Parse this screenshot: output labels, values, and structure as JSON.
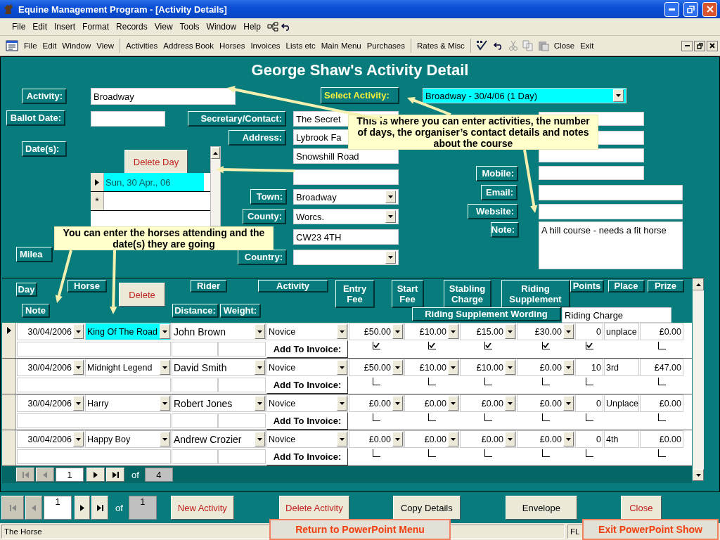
{
  "window": {
    "title": "Equine Management Program - [Activity Details]"
  },
  "menu_bar": [
    "File",
    "Edit",
    "Insert",
    "Format",
    "Records",
    "View",
    "Tools",
    "Window",
    "Help"
  ],
  "toolbar": {
    "window_menu": [
      "File",
      "Edit",
      "Window",
      "View"
    ],
    "sections": [
      "Activities",
      "Address Book",
      "Horses",
      "Invoices",
      "Lists etc",
      "Main Menu",
      "Purchases"
    ],
    "misc": [
      "Rates & Misc"
    ],
    "actions": [
      "Close",
      "Exit"
    ]
  },
  "form": {
    "heading": "George Shaw's Activity Detail",
    "select_activity": {
      "label": "Select Activity:",
      "value": "Broadway - 30/4/06 (1 Day)"
    },
    "fields": [
      {
        "label": "Activity:",
        "value": "Broadway",
        "kind": "text"
      },
      {
        "label": "Ballot Date:",
        "kind": "text"
      },
      {
        "label": "Secretary/Contact:",
        "value": "The Secret",
        "kind": "text"
      },
      {
        "label": "Address:",
        "value": "Lybrook Fa",
        "kind": "text"
      },
      {
        "value": "Snowshill Road",
        "kind": "text"
      },
      {
        "kind": "text"
      },
      {
        "label": "Town:",
        "value": "Broadway",
        "kind": "combo"
      },
      {
        "label": "County:",
        "value": "Worcs.",
        "kind": "combo"
      },
      {
        "value": "CW23 4TH",
        "kind": "text"
      },
      {
        "label": "Country:",
        "kind": "combo"
      },
      {
        "label": "Milea",
        "kind": "label"
      },
      {
        "kind": "text"
      },
      {
        "kind": "text"
      },
      {
        "kind": "text"
      },
      {
        "label": "Mobile:",
        "kind": "text"
      },
      {
        "label": "Email:",
        "kind": "text"
      },
      {
        "label": "Website:",
        "kind": "text"
      },
      {
        "label": "Note:",
        "value": "A hill course - needs a fit horse",
        "kind": "memo"
      }
    ],
    "dates_label": "Date(s):",
    "delete_day_button": "Delete Day",
    "dates": [
      {
        "text": "Sun, 30 Apr., 06",
        "selected": true
      }
    ],
    "new_row_marker": "*",
    "callouts": [
      "This is where you can enter activities, the number of days, the organiser’s contact details and notes about the course",
      "You can enter the horses attending and the date(s) they are going"
    ]
  },
  "subform": {
    "headers": [
      "Day",
      "Horse",
      "Rider",
      "Activity",
      "Entry Fee",
      "Start Fee",
      "Stabling Charge",
      "Riding Supplement",
      "Points",
      "Place",
      "Prize",
      "Note",
      "Distance:",
      "Weight:",
      "Riding Supplement  Wording"
    ],
    "delete_button": "Delete",
    "riding_charge": "Riding Charge",
    "rows": [
      {
        "selected": true,
        "date": "30/04/2006",
        "horse": "King Of The Road",
        "rider": "John Brown",
        "activity": "Novice",
        "fees": [
          "£50.00",
          "£10.00",
          "£15.00",
          "£30.00"
        ],
        "points": "0",
        "place": "unplace",
        "prize": "£0.00",
        "invoice_label": "Add To Invoice:",
        "invoice": [
          {
            "checked": true
          },
          {
            "checked": true
          },
          {
            "checked": true
          },
          {
            "checked": true
          },
          {
            "checked": true
          },
          {
            "checked": false
          }
        ]
      },
      {
        "selected": false,
        "date": "30/04/2006",
        "horse": "Midnight Legend",
        "rider": "David Smith",
        "activity": "Novice",
        "fees": [
          "£50.00",
          "£10.00",
          "£10.00",
          "£0.00"
        ],
        "points": "10",
        "place": "3rd",
        "prize": "£47.00",
        "invoice_label": "Add To Invoice:",
        "invoice": [
          {
            "checked": false
          },
          {
            "checked": false
          },
          {
            "checked": false
          },
          {
            "checked": false
          },
          {
            "checked": false
          },
          {
            "checked": false
          }
        ]
      },
      {
        "selected": false,
        "date": "30/04/2006",
        "horse": "Harry",
        "rider": "Robert Jones",
        "activity": "Novice",
        "fees": [
          "£0.00",
          "£0.00",
          "£0.00",
          "£0.00"
        ],
        "points": "0",
        "place": "Unplace",
        "prize": "£0.00",
        "invoice_label": "Add To Invoice:",
        "invoice": [
          {
            "checked": false
          },
          {
            "checked": false
          },
          {
            "checked": false
          },
          {
            "checked": false
          },
          {
            "checked": false
          },
          {
            "checked": false
          }
        ]
      },
      {
        "selected": false,
        "date": "30/04/2006",
        "horse": "Happy Boy",
        "rider": "Andrew Crozier",
        "activity": "Novice",
        "fees": [
          "£0.00",
          "£0.00",
          "£0.00",
          "£0.00"
        ],
        "points": "0",
        "place": "4th",
        "prize": "£0.00",
        "invoice_label": "Add To Invoice:",
        "invoice": [
          {
            "checked": false
          },
          {
            "checked": false
          },
          {
            "checked": false
          },
          {
            "checked": false
          },
          {
            "checked": false
          },
          {
            "checked": false
          }
        ]
      }
    ],
    "navigator": {
      "record": "1",
      "of": "of",
      "total": "4"
    }
  },
  "navigator": {
    "record": "1",
    "of": "of",
    "total": "1"
  },
  "buttons": [
    "New Activity",
    "Delete Activity",
    "Copy Details",
    "Envelope",
    "Close"
  ],
  "status_bar": {
    "text": "The Horse",
    "indicator": "FL"
  },
  "powerpoint_buttons": [
    "Return to PowerPoint Menu",
    "Exit PowerPoint Show"
  ]
}
